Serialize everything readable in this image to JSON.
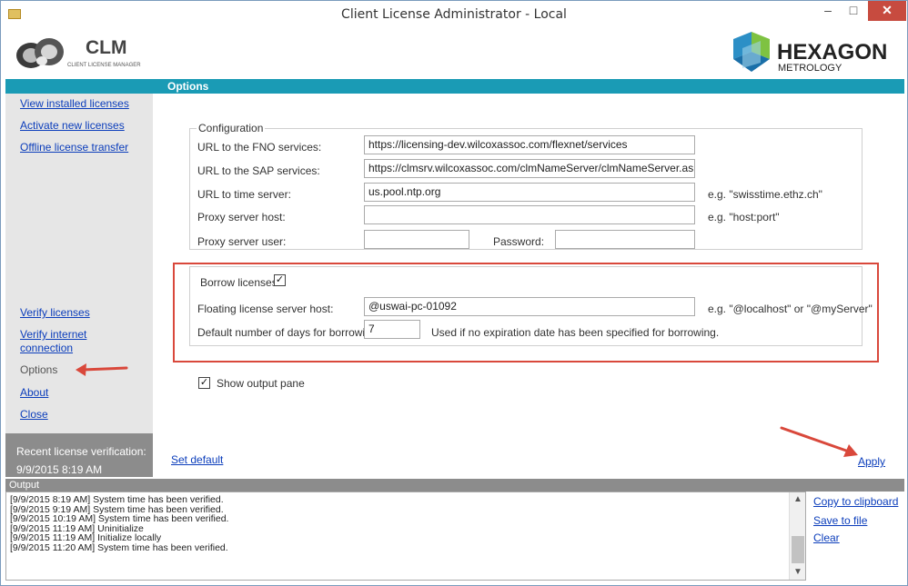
{
  "window": {
    "title": "Client License Administrator - Local",
    "controls": {
      "minimize": "–",
      "maximize": "□",
      "close": "✕"
    }
  },
  "header": {
    "clm_logo_text": "CLM",
    "clm_logo_subtitle": "CLIENT LICENSE MANAGER",
    "brand_name": "HEXAGON",
    "brand_subtitle": "METROLOGY"
  },
  "sidebar": {
    "top_links": [
      {
        "label": "View installed licenses"
      },
      {
        "label": "Activate new licenses"
      },
      {
        "label": "Offline license transfer"
      }
    ],
    "bottom_links": {
      "verify_licenses": "Verify licenses",
      "verify_internet_line1": "Verify internet",
      "verify_internet_line2": "connection",
      "options": "Options",
      "about": "About",
      "close": "Close"
    },
    "status": {
      "label": "Recent license verification:",
      "value": "9/9/2015 8:19 AM"
    }
  },
  "options_panel": {
    "title": "Options",
    "config": {
      "legend": "Configuration",
      "fno_label": "URL to the FNO services:",
      "fno_value": "https://licensing-dev.wilcoxassoc.com/flexnet/services",
      "sap_label": "URL to the SAP services:",
      "sap_value": "https://clmsrv.wilcoxassoc.com/clmNameServer/clmNameServer.asmx",
      "time_label": "URL to time server:",
      "time_value": "us.pool.ntp.org",
      "time_hint": "e.g. \"swisstime.ethz.ch\"",
      "proxy_host_label": "Proxy server host:",
      "proxy_host_value": "",
      "proxy_host_hint": "e.g. \"host:port\"",
      "proxy_user_label": "Proxy server user:",
      "proxy_user_value": "",
      "password_label": "Password:",
      "password_value": ""
    },
    "borrow": {
      "checkbox_label": "Borrow licenses",
      "checked": true,
      "floating_label": "Floating license server host:",
      "floating_value": "@uswai-pc-01092",
      "floating_hint": "e.g. \"@localhost\" or \"@myServer\"",
      "days_label": "Default number of days for borrowing:",
      "days_value": "7",
      "days_hint": "Used if no expiration date has been specified for borrowing."
    },
    "show_output": {
      "label": "Show output pane",
      "checked": true
    },
    "set_default": "Set default",
    "apply": "Apply"
  },
  "output": {
    "title": "Output",
    "lines": [
      "[9/9/2015 8:19 AM] System time has been verified.",
      "[9/9/2015 9:19 AM] System time has been verified.",
      "[9/9/2015 10:19 AM] System time has been verified.",
      "[9/9/2015 11:19 AM] Uninitialize",
      "[9/9/2015 11:19 AM] Initialize locally",
      "[9/9/2015 11:20 AM] System time has been verified."
    ],
    "actions": {
      "copy": "Copy to clipboard",
      "save": "Save to file",
      "clear": "Clear"
    }
  },
  "colors": {
    "accent_teal": "#1a9bb5",
    "link_blue": "#0b3dbb",
    "annotation_red": "#d9483b",
    "sidebar_gray": "#e6e6e6",
    "status_gray": "#8c8c8c"
  }
}
